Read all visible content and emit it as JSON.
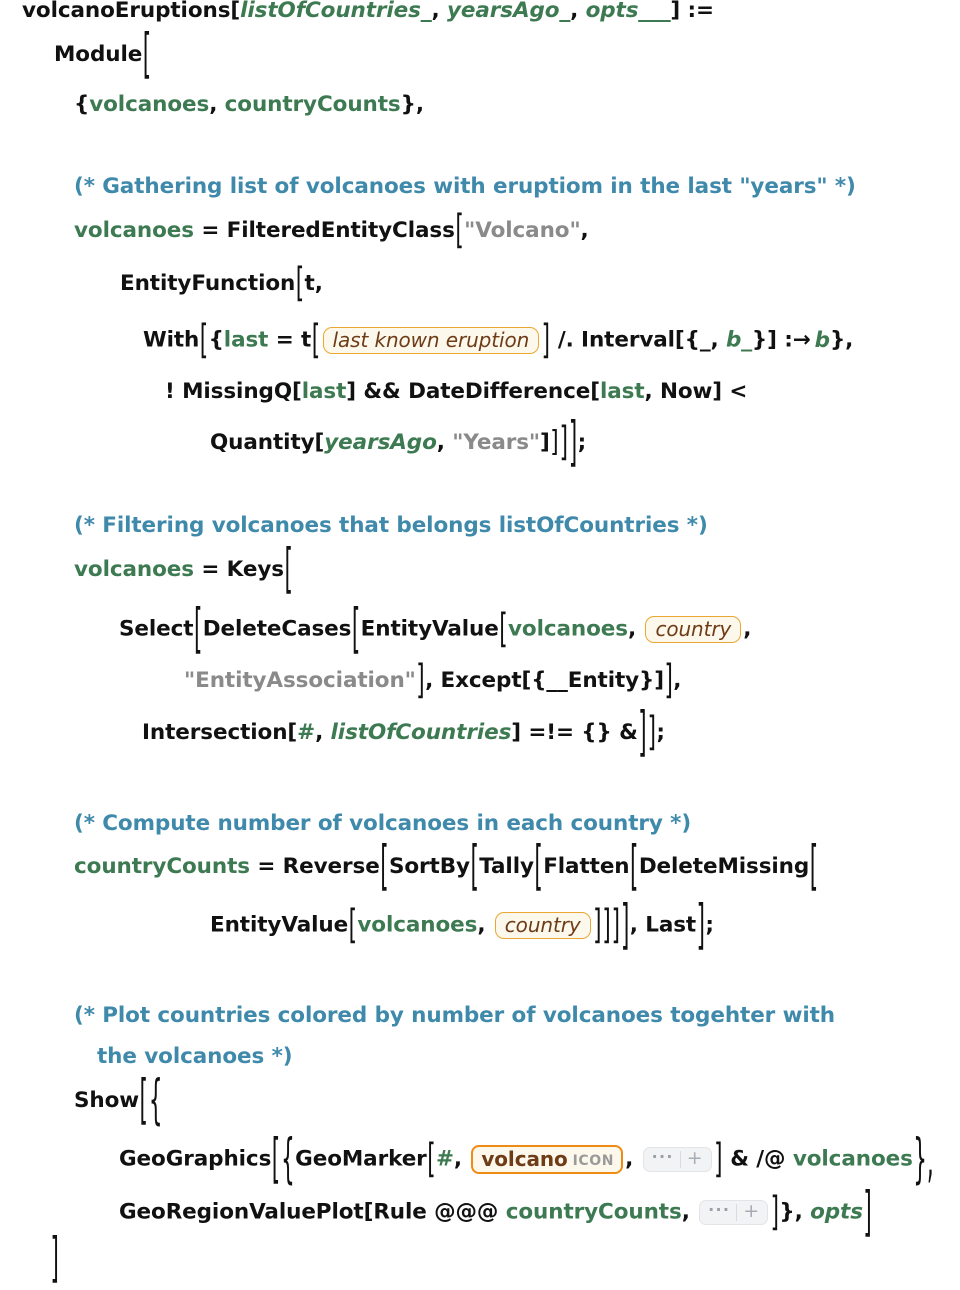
{
  "cell": {
    "kind": "wolfram-language-input-cell",
    "background": "transparent",
    "colors": {
      "symbol": "#111111",
      "local_variable": "#3d7a52",
      "pattern_variable": "#3d7a52",
      "string": "#8a8a8a",
      "comment": "#3f89ab",
      "entity_border": "#eba734",
      "entity_fill": "#fdf8ec",
      "entity_text": "#6e3c17",
      "icon_border": "#ef8b12",
      "expander_fill": "#f2f3f5"
    }
  },
  "code": {
    "l1": {
      "fn": "volcanoEruptions[",
      "arg1": "listOfCountries_",
      "c1": ", ",
      "arg2": "yearsAgo_",
      "c2": ", ",
      "arg3": "opts___",
      "tail": "] :="
    },
    "l2": {
      "text": "Module"
    },
    "l3": {
      "open": "{",
      "v1": "volcanoes",
      "sep": ", ",
      "v2": "countryCounts",
      "close": "},"
    },
    "c1": {
      "text": "(* Gathering list of volcanoes with eruptiom in the last \"years\" *)"
    },
    "l4": {
      "lhs": "volcanoes",
      "eq": " = ",
      "fn": "FilteredEntityClass",
      "arg": "\"Volcano\"",
      "tail": ","
    },
    "l5": {
      "fn": "EntityFunction",
      "arg": "t,"
    },
    "l6": {
      "fn": "With",
      "open": "{",
      "var": "last",
      "eq": " = t",
      "entity": "last known eruption",
      "mid": " /. Interval[{_, ",
      "b1": "b_",
      "mid2": "}] ",
      "arrow": ":→",
      "b2": "b",
      "close": "},"
    },
    "l7": {
      "p1": "! MissingQ[",
      "v1": "last",
      "p2": "] && DateDifference[",
      "v2": "last",
      "p3": ", Now] <"
    },
    "l8": {
      "fn": "Quantity[",
      "var": "yearsAgo",
      "sep": ", ",
      "str": "\"Years\"",
      "tail": "]"
    },
    "c2": {
      "text": "(* Filtering volcanoes that belongs listOfCountries *)"
    },
    "l9": {
      "lhs": "volcanoes",
      "eq": " = ",
      "fn": "Keys"
    },
    "l10": {
      "fns": "SelectDeleteCasesEntityValue",
      "f1": "Select",
      "f2": "DeleteCases",
      "f3": "EntityValue",
      "v": "volcanoes",
      "sep": ", ",
      "entity": "country",
      "tail": ","
    },
    "l11": {
      "str": "\"EntityAssociation\"",
      "mid": ", Except[{__Entity}]",
      "tail": ","
    },
    "l12": {
      "fn": "Intersection[",
      "slot": "#",
      "sep": ", ",
      "var": "listOfCountries",
      "tail": "] =!= {} &"
    },
    "c3": {
      "text": "(* Compute number of volcanoes in each country *)"
    },
    "l13": {
      "lhs": "countryCounts",
      "eq": " = ",
      "f1": "Reverse",
      "f2": "SortBy",
      "f3": "Tally",
      "f4": "Flatten",
      "f5": "DeleteMissing"
    },
    "l14": {
      "fn": "EntityValue",
      "v": "volcanoes",
      "sep": ", ",
      "entity": "country",
      "tail": ", Last"
    },
    "c4": {
      "line1": "(* Plot countries colored by number of volcanoes togehter with",
      "line2": "the volcanoes *)"
    },
    "l15": {
      "fn": "Show",
      "open": "{"
    },
    "l16": {
      "f1": "GeoGraphics",
      "open": "{",
      "f2": "GeoMarker",
      "slot": "#",
      "sep": ", ",
      "entity": "volcano",
      "entity_kind": "ICON",
      "mid": ", ",
      "tail": " & /@ ",
      "v": "volcanoes",
      "close": "},"
    },
    "l17": {
      "f1": "GeoRegionValuePlot",
      "op": "[Rule @@@ ",
      "v": "countryCounts",
      "sep": ", ",
      "close": "}, ",
      "opts": "opts"
    },
    "l18": {
      "text": "]"
    }
  },
  "widgets": {
    "expander": {
      "dots": "···",
      "plus": "+"
    }
  }
}
